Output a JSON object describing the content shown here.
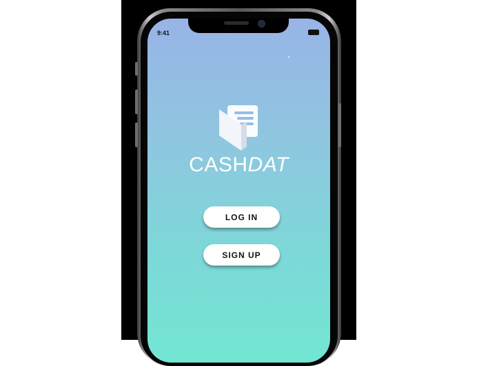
{
  "status_bar": {
    "time": "9:41"
  },
  "brand": {
    "part1": "CASH",
    "part2": "DAT"
  },
  "buttons": {
    "login": "LOG IN",
    "signup": "SIGN UP"
  },
  "icons": {
    "logo": "wallet-receipt-icon",
    "battery": "battery-icon",
    "camera": "camera-icon",
    "speaker": "speaker-icon"
  },
  "colors": {
    "gradient_top": "#98b4e6",
    "gradient_bottom": "#72e6d3",
    "button_bg": "#ffffff",
    "button_text": "#111111"
  }
}
